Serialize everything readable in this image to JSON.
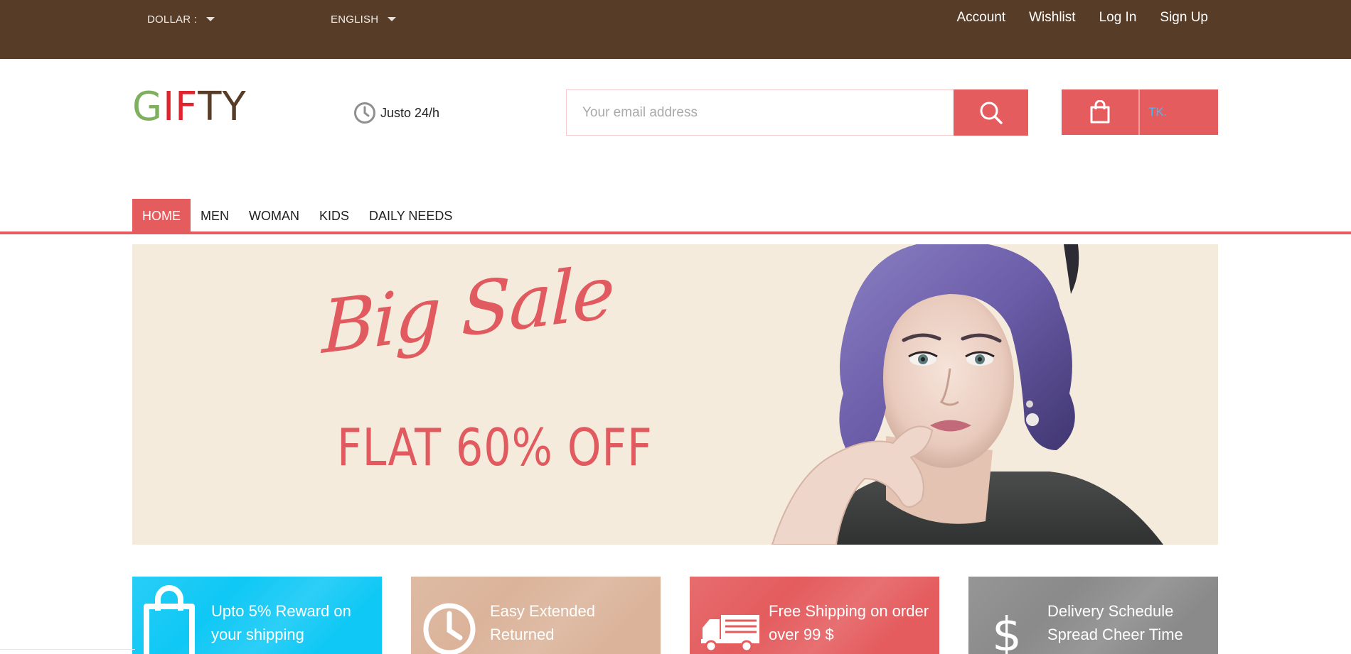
{
  "topbar": {
    "currency_label": "DOLLAR :",
    "language_label": "ENGLISH",
    "links": [
      "Account",
      "Wishlist",
      "Log In",
      "Sign Up"
    ]
  },
  "header": {
    "logo_letters": [
      "G",
      "I",
      "F",
      "T",
      "Y"
    ],
    "logo_colors": [
      "#7eb05e",
      "#e0232c",
      "#e0232c",
      "#573c27",
      "#573c27"
    ],
    "hours_text": "Justo 24/h",
    "search_placeholder": "Your email address",
    "cart_label": "TK."
  },
  "nav": {
    "items": [
      "HOME",
      "MEN",
      "WOMAN",
      "KIDS",
      "DAILY NEEDS"
    ],
    "active": "HOME"
  },
  "banner": {
    "script_text": "Big Sale",
    "offer_text": "FLAT 60% OFF"
  },
  "features": [
    {
      "line1": "Upto 5% Reward on",
      "line2": "your shipping",
      "icon": "shopping-bag-icon",
      "color": "#0fc8f5"
    },
    {
      "line1": "Easy Extended",
      "line2": "Returned",
      "icon": "clock-icon",
      "color": "#dbb39a"
    },
    {
      "line1": "Free Shipping on order",
      "line2": "over 99 $",
      "icon": "truck-icon",
      "color": "#e45c5e"
    },
    {
      "line1": "Delivery Schedule",
      "line2": "Spread Cheer Time",
      "icon": "dollar-icon",
      "color": "#8a8a8a"
    }
  ],
  "colors": {
    "topbar": "#573c27",
    "accent": "#e45c5e",
    "banner_bg": "#f5ebdc"
  }
}
